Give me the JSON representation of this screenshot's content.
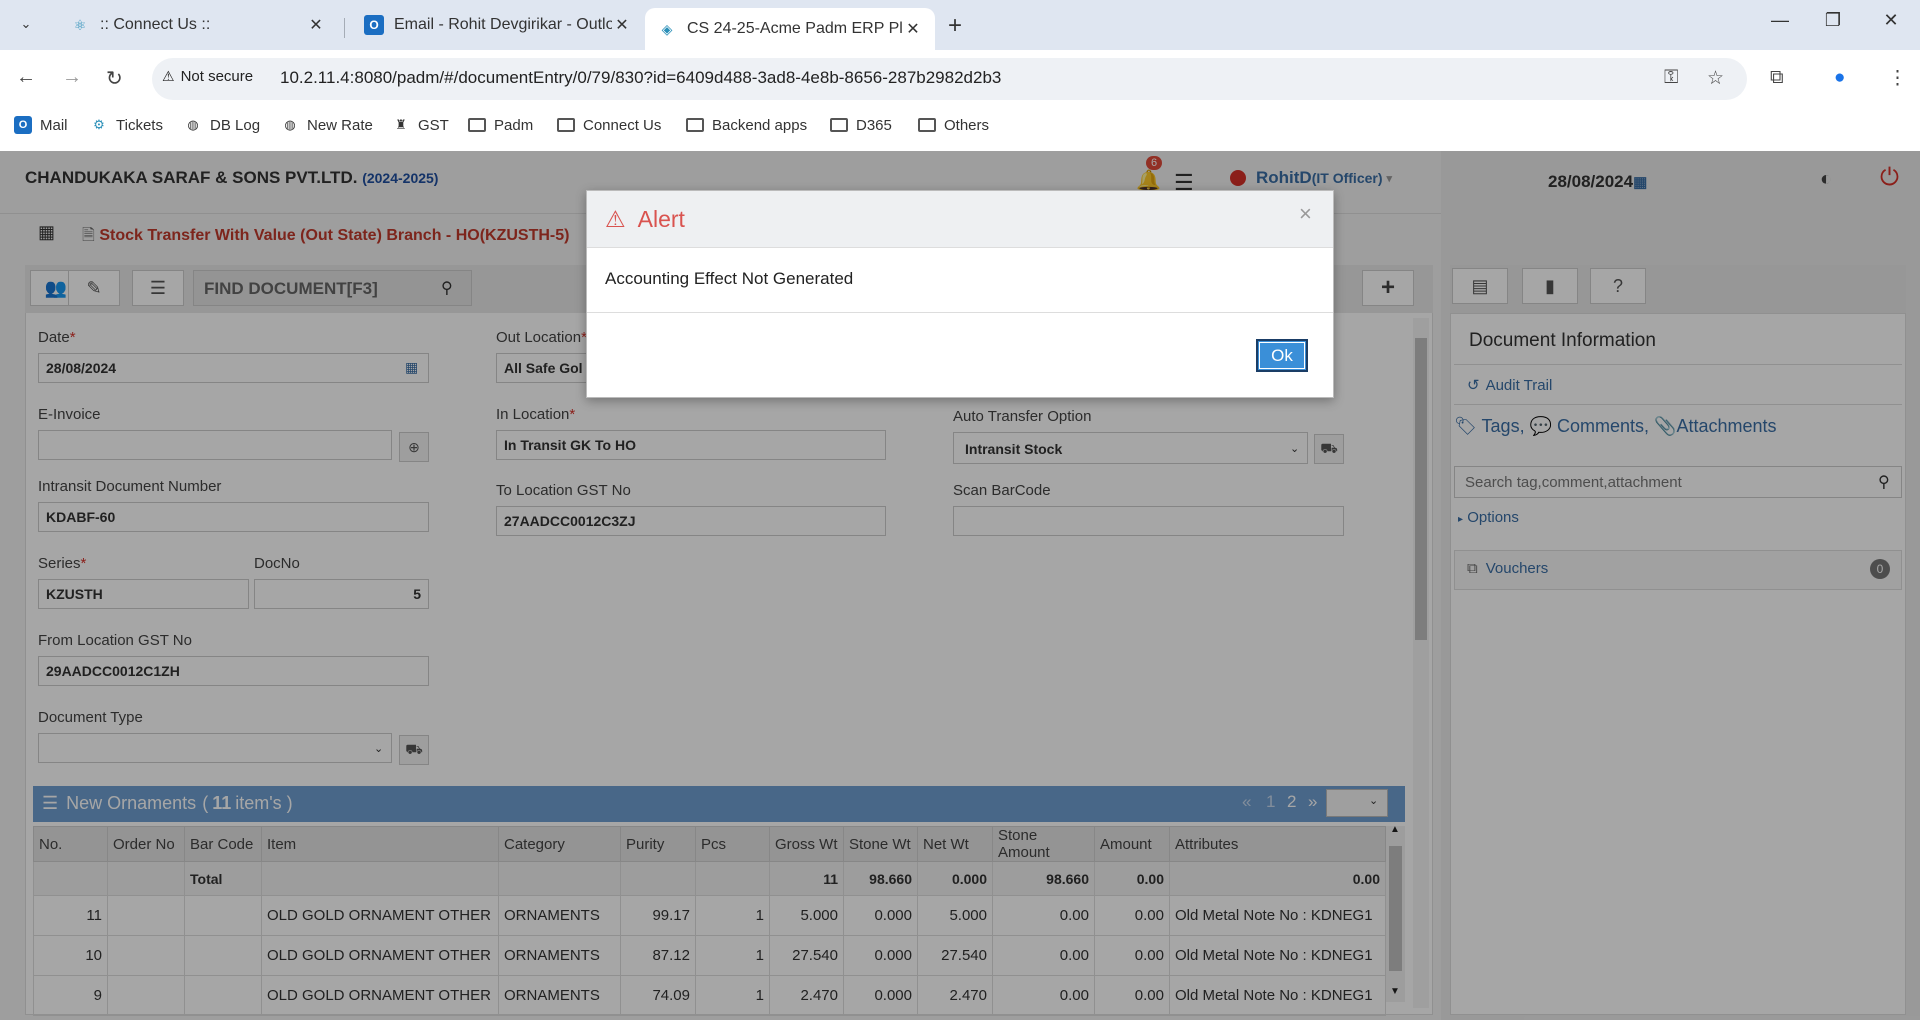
{
  "browser": {
    "tabs": [
      {
        "title": ":: Connect Us ::",
        "icon": "react-icon"
      },
      {
        "title": "Email - Rohit Devgirikar - Outlook",
        "icon": "outlook-icon"
      },
      {
        "title": "CS 24-25-Acme Padm ERP Platform",
        "icon": "erp-icon"
      }
    ],
    "security_label": "Not secure",
    "url": "10.2.11.4:8080/padm/#/documentEntry/0/79/830?id=6409d488-3ad8-4e8b-8656-287b2982d2b3",
    "bookmarks": [
      "Mail",
      "Tickets",
      "DB Log",
      "New Rate",
      "GST",
      "Padm",
      "Connect Us",
      "Backend apps",
      "D365",
      "Others"
    ]
  },
  "header": {
    "company": "CHANDUKAKA SARAF & SONS PVT.LTD.",
    "fiscal_year": "(2024-2025)",
    "notification_count": "6",
    "user": "RohitD",
    "role": "(IT Officer)",
    "date": "28/08/2024"
  },
  "document": {
    "title": "Stock Transfer With Value (Out State) Branch - HO(KZUSTH-5)",
    "find_label": "FIND DOCUMENT[F3]"
  },
  "form": {
    "date_label": "Date",
    "date_value": "28/08/2024",
    "einvoice_label": "E-Invoice",
    "einvoice_value": "",
    "intransit_label": "Intransit Document Number",
    "intransit_value": "KDABF-60",
    "series_label": "Series",
    "series_value": "KZUSTH",
    "docno_label": "DocNo",
    "docno_value": "5",
    "from_gst_label": "From Location GST No",
    "from_gst_value": "29AADCC0012C1ZH",
    "doctype_label": "Document Type",
    "doctype_value": "",
    "out_location_label": "Out Location",
    "out_location_value": "All Safe Gol",
    "in_location_label": "In Location",
    "in_location_value": "In Transit GK To HO",
    "to_gst_label": "To Location GST No",
    "to_gst_value": "27AADCC0012C3ZJ",
    "auto_transfer_label": "Auto Transfer Option",
    "auto_transfer_value": "Intransit Stock",
    "scan_label": "Scan BarCode",
    "scan_value": ""
  },
  "grid": {
    "title": "New Ornaments",
    "count": "11",
    "count_suffix": "item's )",
    "pages": [
      "«",
      "1",
      "2",
      "»"
    ],
    "columns": [
      "No.",
      "Order No",
      "Bar Code",
      "Item",
      "Category",
      "Purity",
      "Pcs",
      "Gross Wt",
      "Stone Wt",
      "Net Wt",
      "Stone Amount",
      "Amount",
      "Attributes"
    ],
    "total": {
      "label": "Total",
      "pcs": "11",
      "gross": "98.660",
      "stone": "0.000",
      "net": "98.660",
      "stone_amount": "0.00",
      "amount": "0.00"
    },
    "rows": [
      {
        "no": "11",
        "order": "",
        "barcode": "",
        "item": "OLD GOLD ORNAMENT OTHER",
        "category": "ORNAMENTS",
        "purity": "99.17",
        "pcs": "1",
        "gross": "5.000",
        "stone": "0.000",
        "net": "5.000",
        "stone_amount": "0.00",
        "amount": "0.00",
        "attributes": "Old Metal Note No : KDNEG1"
      },
      {
        "no": "10",
        "order": "",
        "barcode": "",
        "item": "OLD GOLD ORNAMENT OTHER",
        "category": "ORNAMENTS",
        "purity": "87.12",
        "pcs": "1",
        "gross": "27.540",
        "stone": "0.000",
        "net": "27.540",
        "stone_amount": "0.00",
        "amount": "0.00",
        "attributes": "Old Metal Note No : KDNEG1"
      },
      {
        "no": "9",
        "order": "",
        "barcode": "",
        "item": "OLD GOLD ORNAMENT OTHER",
        "category": "ORNAMENTS",
        "purity": "74.09",
        "pcs": "1",
        "gross": "2.470",
        "stone": "0.000",
        "net": "2.470",
        "stone_amount": "0.00",
        "amount": "0.00",
        "attributes": "Old Metal Note No : KDNEG1"
      }
    ]
  },
  "side": {
    "title": "Document Information",
    "audit": "Audit Trail",
    "tags": "Tags,",
    "comments": "Comments,",
    "attachments": "Attachments",
    "search_placeholder": "Search tag,comment,attachment",
    "options": "Options",
    "vouchers": "Vouchers",
    "vouchers_count": "0"
  },
  "modal": {
    "title": "Alert",
    "message": "Accounting Effect Not Generated",
    "close": "×",
    "ok": "Ok"
  }
}
